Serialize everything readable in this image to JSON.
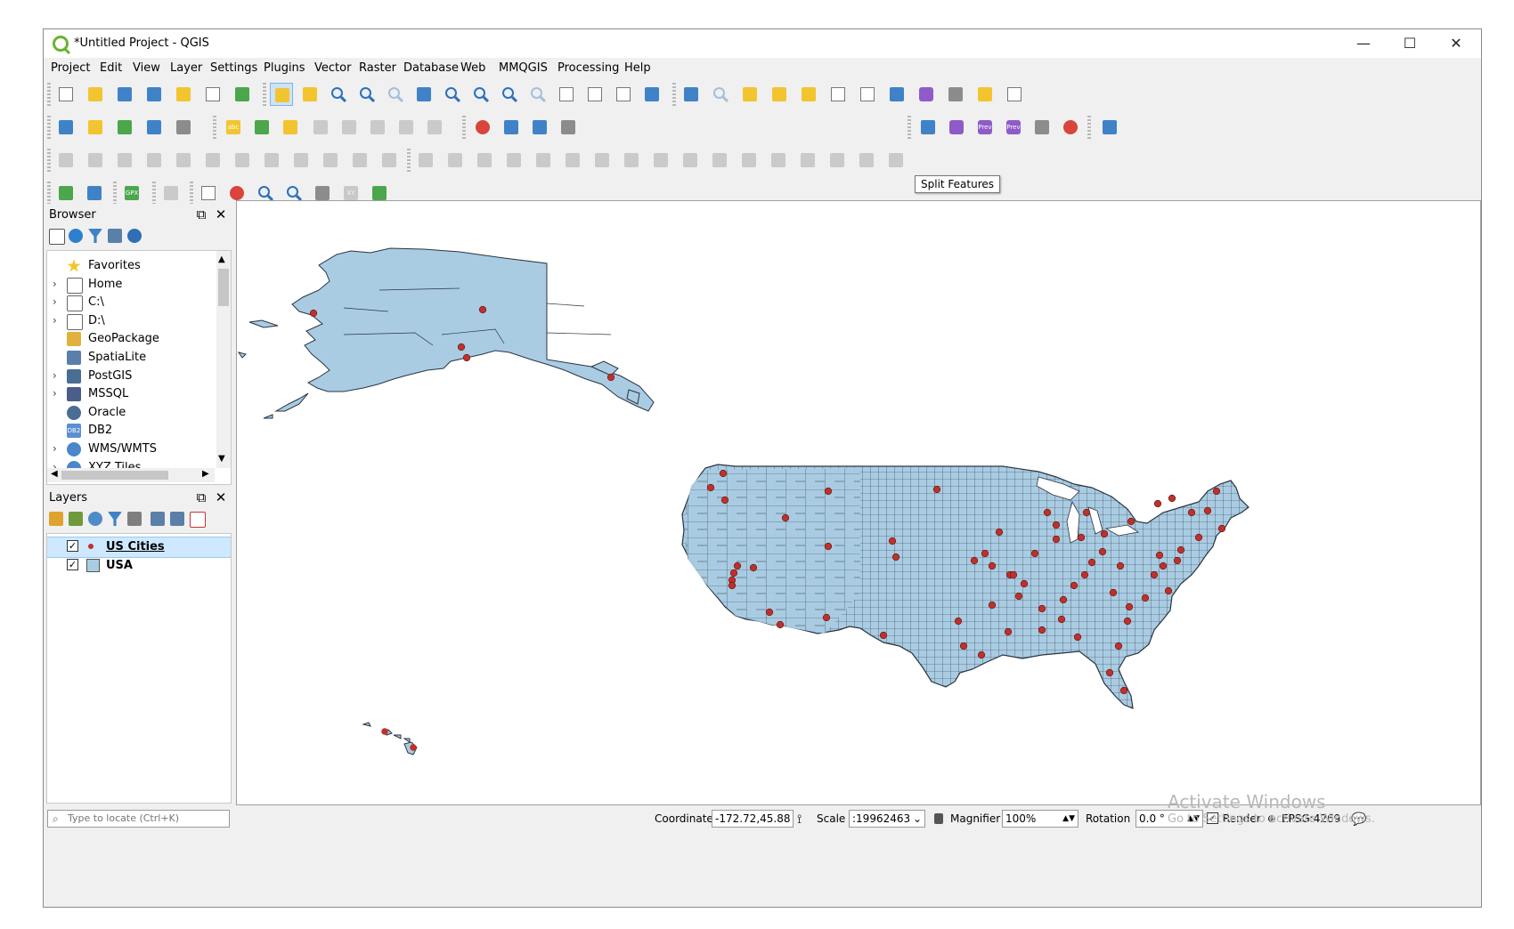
{
  "window": {
    "title": "*Untitled Project - QGIS",
    "controls": {
      "minimize": "—",
      "maximize": "☐",
      "close": "✕"
    }
  },
  "menubar": [
    "Project",
    "Edit",
    "View",
    "Layer",
    "Settings",
    "Plugins",
    "Vector",
    "Raster",
    "Database",
    "Web",
    "MMQGIS",
    "Processing",
    "Help"
  ],
  "toolbars": {
    "tooltip": "Split Features",
    "labels": {
      "abc": "abc",
      "gpx": "GPX",
      "xy": "XY",
      "prev_inter": "Prev Inter",
      "prev_clip": "Prev Clip"
    },
    "icons": [
      "new-project-icon",
      "open-project-icon",
      "save-project-icon",
      "save-as-icon",
      "print-layout-icon",
      "layout-manager-icon",
      "style-manager-icon",
      "pan-icon",
      "pan-to-selection-icon",
      "zoom-in-icon",
      "zoom-out-icon",
      "zoom-native-icon",
      "zoom-full-icon",
      "zoom-selection-icon",
      "zoom-layer-icon",
      "zoom-last-icon",
      "zoom-next-icon",
      "new-bookmark-icon",
      "show-bookmarks-icon",
      "temporal-icon",
      "refresh-icon",
      "identify-icon",
      "select-icon",
      "attribute-table-icon",
      "field-calculator-icon",
      "statistics-icon",
      "measure-icon",
      "map-tips-icon",
      "text-annotation-icon",
      "python-icon",
      "help-icon"
    ]
  },
  "browser": {
    "title": "Browser",
    "items": [
      {
        "label": "Favorites",
        "expandable": false,
        "icon": "star-icon"
      },
      {
        "label": "Home",
        "expandable": true,
        "icon": "home-folder-icon"
      },
      {
        "label": "C:\\",
        "expandable": true,
        "icon": "folder-icon"
      },
      {
        "label": "D:\\",
        "expandable": true,
        "icon": "folder-icon"
      },
      {
        "label": "GeoPackage",
        "expandable": false,
        "icon": "geopackage-icon"
      },
      {
        "label": "SpatiaLite",
        "expandable": false,
        "icon": "spatialite-icon"
      },
      {
        "label": "PostGIS",
        "expandable": true,
        "icon": "postgis-icon"
      },
      {
        "label": "MSSQL",
        "expandable": true,
        "icon": "mssql-icon"
      },
      {
        "label": "Oracle",
        "expandable": false,
        "icon": "oracle-icon"
      },
      {
        "label": "DB2",
        "expandable": false,
        "icon": "db2-icon"
      },
      {
        "label": "WMS/WMTS",
        "expandable": true,
        "icon": "wms-icon"
      },
      {
        "label": "XYZ Tiles",
        "expandable": true,
        "icon": "xyz-tiles-icon"
      }
    ],
    "db2_badge": "DB2"
  },
  "layers": {
    "title": "Layers",
    "items": [
      {
        "label": "US Cities",
        "checked": true,
        "selected": true,
        "symbol": "point",
        "color": "#c0302b"
      },
      {
        "label": "USA",
        "checked": true,
        "selected": false,
        "symbol": "polygon",
        "color": "#a9cce3"
      }
    ]
  },
  "statusbar": {
    "locate_placeholder": "Type to locate (Ctrl+K)",
    "coordinate_label": "Coordinate",
    "coordinate_value": "-172.72,45.88",
    "scale_label": "Scale",
    "scale_value": ":19962463",
    "magnifier_label": "Magnifier",
    "magnifier_value": "100%",
    "rotation_label": "Rotation",
    "rotation_value": "0.0 °",
    "render_label": "Render",
    "render_checked": true,
    "crs": "EPSG:4269"
  },
  "watermark": {
    "line1": "Activate Windows",
    "line2": "Go to Settings to activate Windows."
  },
  "colors": {
    "land_fill": "#a9cce3",
    "land_stroke": "#2b3440",
    "city_point": "#c0302b",
    "selection": "#cde8ff"
  }
}
